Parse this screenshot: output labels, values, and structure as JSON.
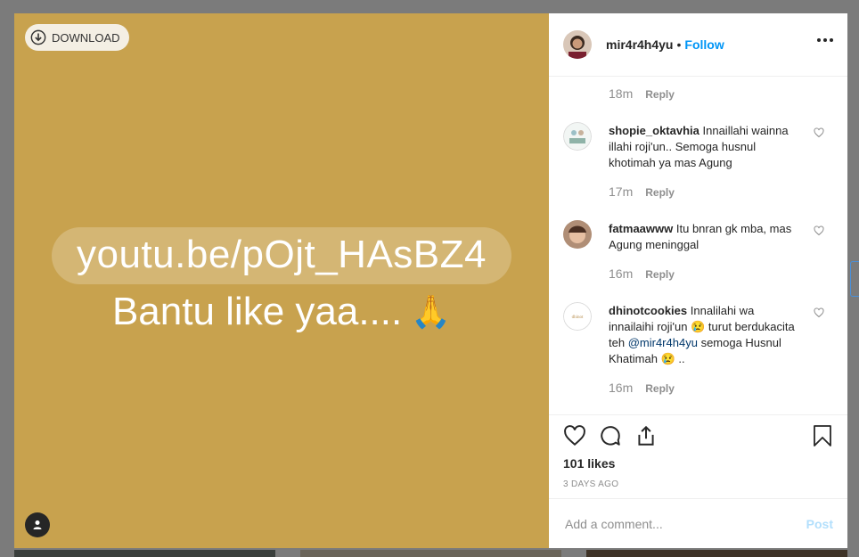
{
  "media": {
    "download_label": "DOWNLOAD",
    "overlay_line1": "youtu.be/pOjt_HAsBZ4",
    "overlay_line2": "Bantu like yaa....",
    "overlay_emoji": "🙏"
  },
  "header": {
    "username": "mir4r4h4yu",
    "separator": "•",
    "follow_label": "Follow"
  },
  "comments": {
    "top_meta": {
      "time": "18m",
      "reply": "Reply"
    },
    "items": [
      {
        "user": "shopie_oktavhia",
        "text": "Innaillahi wainna illahi roji'un.. Semoga husnul khotimah ya mas Agung",
        "time": "17m",
        "reply": "Reply"
      },
      {
        "user": "fatmaawww",
        "text": "Itu bnran gk mba, mas Agung meninggal",
        "time": "16m",
        "reply": "Reply"
      },
      {
        "user": "dhinotcookies",
        "text_a": "Innalilahi wa innailaihi roji'un",
        "emoji_a": "😢",
        "text_b": "turut berdukacita teh",
        "mention": "@mir4r4h4yu",
        "text_c": "semoga Husnul Khatimah",
        "emoji_b": "😢",
        "text_d": "..",
        "time": "16m",
        "reply": "Reply"
      }
    ]
  },
  "post": {
    "likes": "101 likes",
    "posted_ago": "3 DAYS AGO"
  },
  "add_comment": {
    "placeholder": "Add a comment...",
    "post_label": "Post"
  },
  "colors": {
    "media_bg": "#c8a24e",
    "link_blue": "#0095f6",
    "post_disabled": "#b2dffc"
  }
}
